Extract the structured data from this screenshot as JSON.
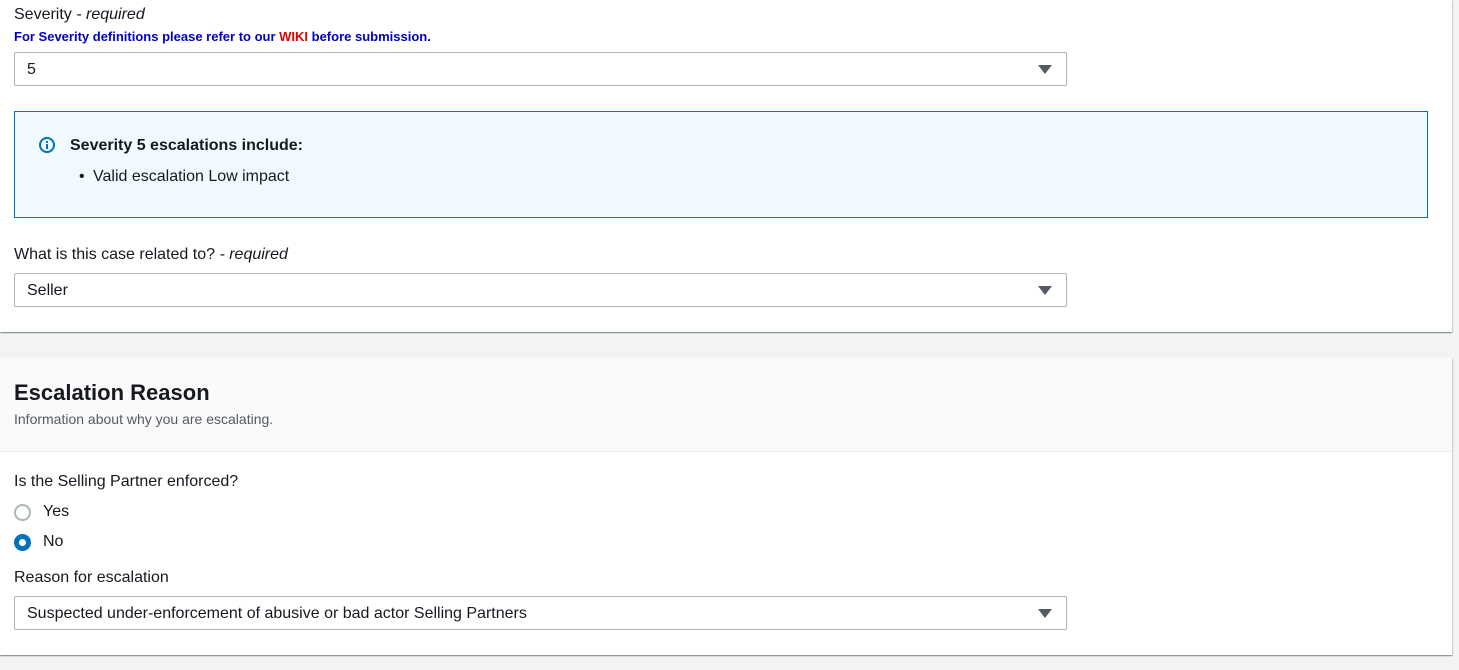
{
  "severity": {
    "label": "Severity",
    "required": "- required",
    "hint_prefix": "For Severity definitions please refer to our ",
    "hint_link": "WIKI",
    "hint_suffix": " before submission.",
    "selected": "5"
  },
  "info_alert": {
    "title": "Severity 5 escalations include:",
    "items": [
      "Valid escalation Low impact"
    ]
  },
  "case_related": {
    "label": "What is this case related to?",
    "required": "- required",
    "selected": "Seller"
  },
  "escalation_section": {
    "title": "Escalation Reason",
    "description": "Information about why you are escalating."
  },
  "enforced": {
    "label": "Is the Selling Partner enforced?",
    "options": [
      {
        "label": "Yes",
        "checked": false
      },
      {
        "label": "No",
        "checked": true
      }
    ]
  },
  "reason": {
    "label": "Reason for escalation",
    "selected": "Suspected under-enforcement of abusive or bad actor Selling Partners"
  },
  "colors": {
    "accent": "#0073bb",
    "hint_blue": "#0000cc",
    "wiki_red": "#e00000",
    "info_bg": "#f1faff"
  },
  "icons": {
    "info": "info-icon",
    "caret": "caret-down-icon"
  }
}
